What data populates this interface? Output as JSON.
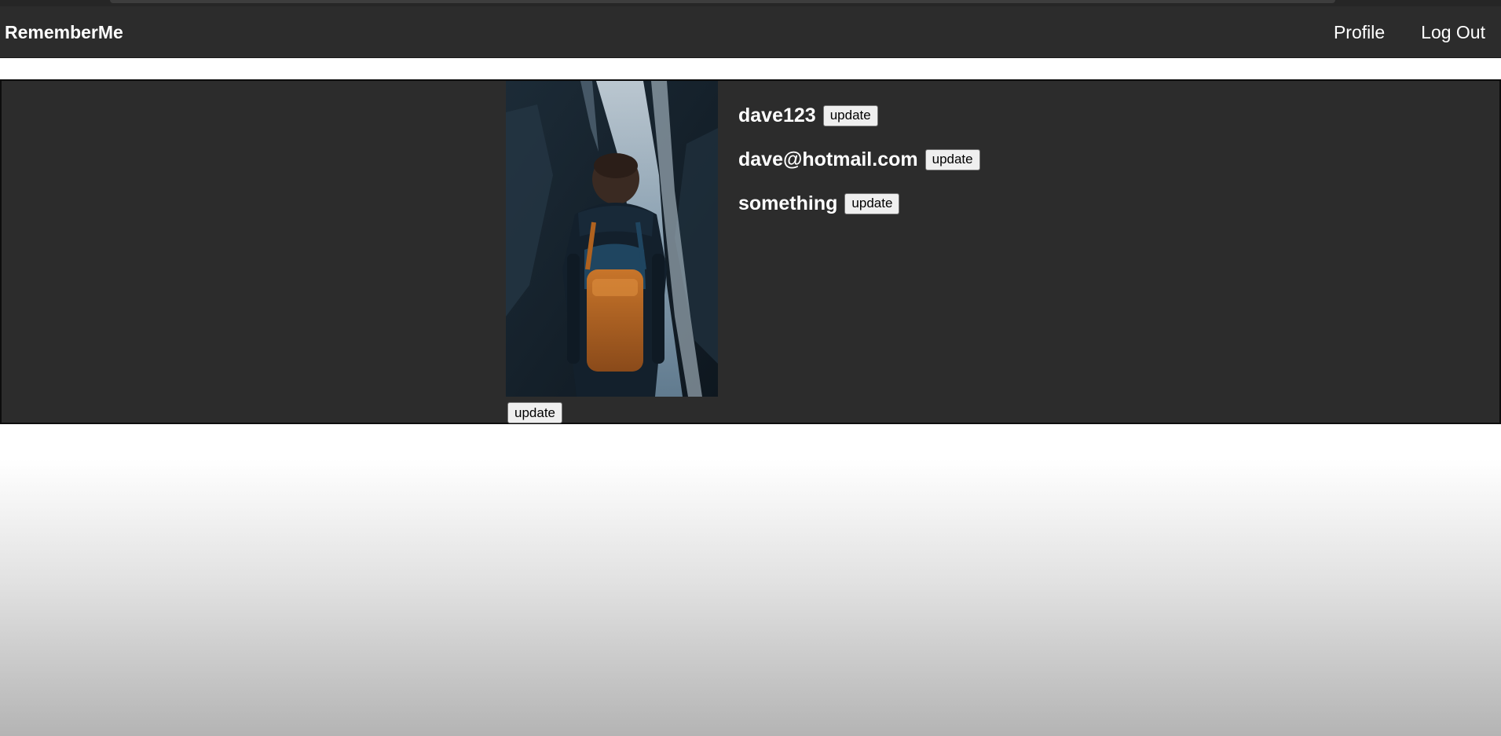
{
  "navbar": {
    "brand": "RememberMe",
    "links": [
      "Profile",
      "Log Out"
    ]
  },
  "profile": {
    "username": "dave123",
    "email": "dave@hotmail.com",
    "bio": "something",
    "update_label": "update",
    "photo_update_label": "update"
  },
  "colors": {
    "navbar_bg": "#2c2c2c",
    "panel_bg": "#2c2c2c",
    "text": "#ffffff"
  }
}
